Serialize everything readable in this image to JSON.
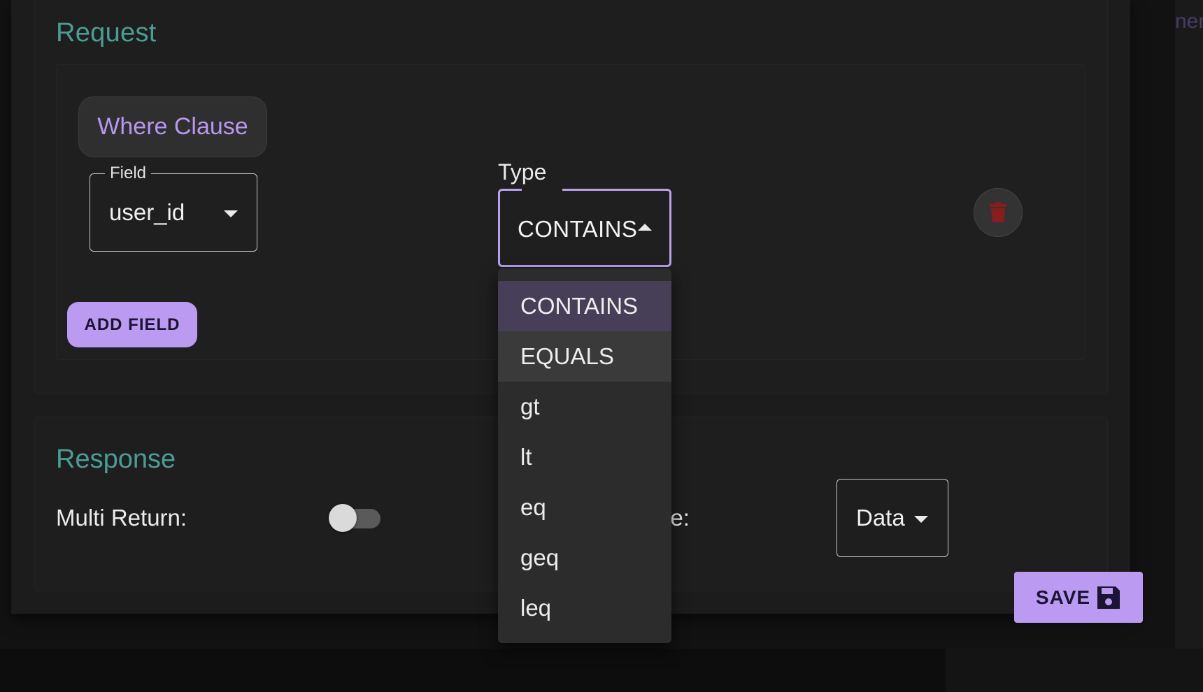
{
  "background": {
    "peek_text": "ner"
  },
  "request": {
    "title": "Request",
    "chip_label": "Where Clause",
    "field": {
      "legend": "Field",
      "value": "user_id"
    },
    "type": {
      "label": "Type",
      "value": "CONTAINS",
      "options": [
        "CONTAINS",
        "EQUALS",
        "gt",
        "lt",
        "eq",
        "geq",
        "leq"
      ],
      "selected_index": 0,
      "hovered_index": 1
    },
    "add_field_label": "ADD FIELD"
  },
  "response": {
    "title": "Response",
    "multi_return_label": "Multi Return:",
    "multi_return_on": false,
    "type_label_visible": "pe:",
    "type_value": "Data"
  },
  "save_label": "SAVE",
  "colors": {
    "accent": "#bb9af2",
    "section_title": "#4a9d94",
    "delete_icon": "#8a1c1c"
  }
}
